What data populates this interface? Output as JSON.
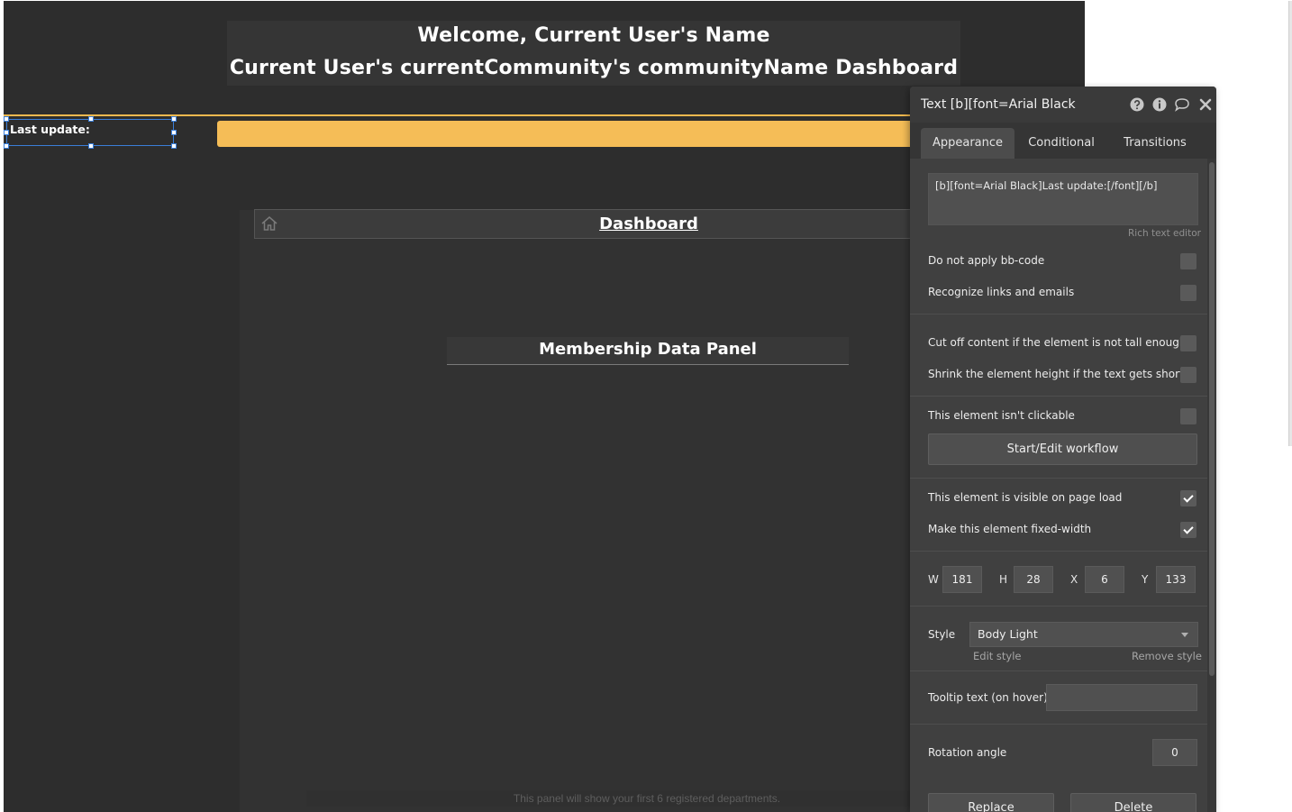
{
  "canvas": {
    "welcome_text": "Welcome, Current User's Name",
    "dashboard_heading": "Current User's currentCommunity's communityName Dashboard",
    "last_update_label": "Last update:",
    "dashboard_title": "Dashboard",
    "membership_panel_title": "Membership Data Panel",
    "footer_note": "This panel will show your first 6 registered departments."
  },
  "editor": {
    "title": "Text [b][font=Arial Black",
    "tabs": [
      {
        "label": "Appearance",
        "active": true
      },
      {
        "label": "Conditional",
        "active": false
      },
      {
        "label": "Transitions",
        "active": false
      }
    ],
    "text_content": "[b][font=Arial Black]Last update:[/font][/b]",
    "rich_text_editor_label": "Rich text editor",
    "options": [
      {
        "label": "Do not apply bb-code",
        "checked": false
      },
      {
        "label": "Recognize links and emails",
        "checked": false
      },
      {
        "label": "Cut off content if the element is not tall enough",
        "checked": false
      },
      {
        "label": "Shrink the element height if the text gets shorter",
        "checked": false
      },
      {
        "label": "This element isn't clickable",
        "checked": false
      },
      {
        "label": "This element is visible on page load",
        "checked": true
      },
      {
        "label": "Make this element fixed-width",
        "checked": true
      }
    ],
    "workflow_button": "Start/Edit workflow",
    "dimensions": {
      "w_label": "W",
      "w_value": "181",
      "h_label": "H",
      "h_value": "28",
      "x_label": "X",
      "x_value": "6",
      "y_label": "Y",
      "y_value": "133"
    },
    "style_label": "Style",
    "style_value": "Body Light",
    "edit_style_link": "Edit style",
    "remove_style_link": "Remove style",
    "tooltip_label": "Tooltip text (on hover)",
    "tooltip_value": "",
    "rotation_label": "Rotation angle",
    "rotation_value": "0",
    "replace_button": "Replace",
    "delete_button": "Delete"
  },
  "colors": {
    "accent_orange": "#f5bd57",
    "selection_blue": "#3a7ed8",
    "canvas_bg": "#2d2d2d"
  },
  "icons": [
    "home-icon",
    "help-icon",
    "info-icon",
    "comment-icon",
    "close-icon",
    "chevron-down-icon"
  ]
}
